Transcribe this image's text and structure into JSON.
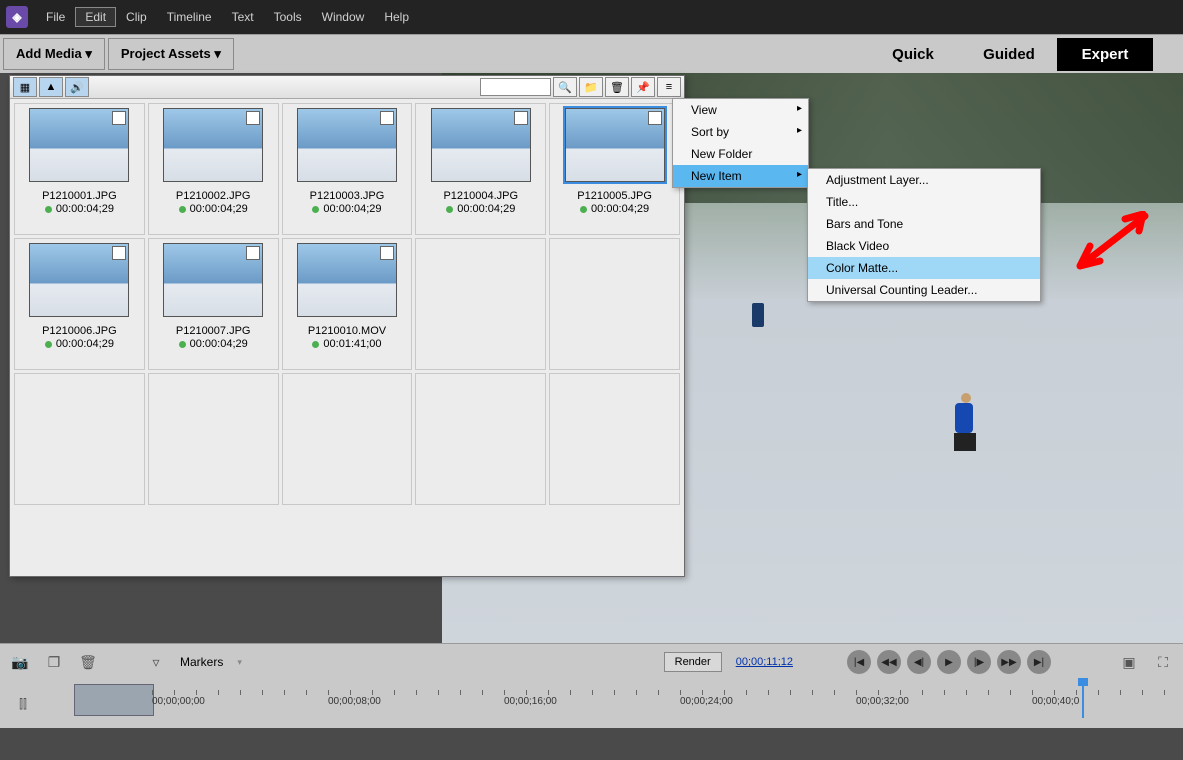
{
  "menus": [
    "File",
    "Edit",
    "Clip",
    "Timeline",
    "Text",
    "Tools",
    "Window",
    "Help"
  ],
  "active_menu": 1,
  "workspace": {
    "add_media": "Add Media ▾",
    "project_assets": "Project Assets ▾",
    "tabs": [
      "Quick",
      "Guided",
      "Expert"
    ],
    "active_tab": 2
  },
  "assets": {
    "search_placeholder": "",
    "items": [
      {
        "name": "P1210001.JPG",
        "dur": "00:00:04;29"
      },
      {
        "name": "P1210002.JPG",
        "dur": "00:00:04;29"
      },
      {
        "name": "P1210003.JPG",
        "dur": "00:00:04;29"
      },
      {
        "name": "P1210004.JPG",
        "dur": "00:00:04;29"
      },
      {
        "name": "P1210005.JPG",
        "dur": "00:00:04;29",
        "selected": true
      },
      {
        "name": "P1210006.JPG",
        "dur": "00:00:04;29"
      },
      {
        "name": "P1210007.JPG",
        "dur": "00:00:04;29"
      },
      {
        "name": "P1210010.MOV",
        "dur": "00:01:41;00"
      }
    ]
  },
  "ctx1": {
    "items": [
      "View",
      "Sort by",
      "New Folder",
      "New Item"
    ],
    "selected": 3,
    "has_arrow": [
      0,
      1,
      3
    ]
  },
  "ctx2": {
    "items": [
      "Adjustment Layer...",
      "Title...",
      "Bars and Tone",
      "Black Video",
      "Color Matte...",
      "Universal Counting Leader..."
    ],
    "selected": 4
  },
  "toolbar": {
    "markers": "Markers",
    "render": "Render",
    "timecode": "00;00;11;12"
  },
  "ruler": [
    "00;00;00;00",
    "00;00;08;00",
    "00;00;16;00",
    "00;00;24;00",
    "00;00;32;00",
    "00;00;40;0"
  ]
}
